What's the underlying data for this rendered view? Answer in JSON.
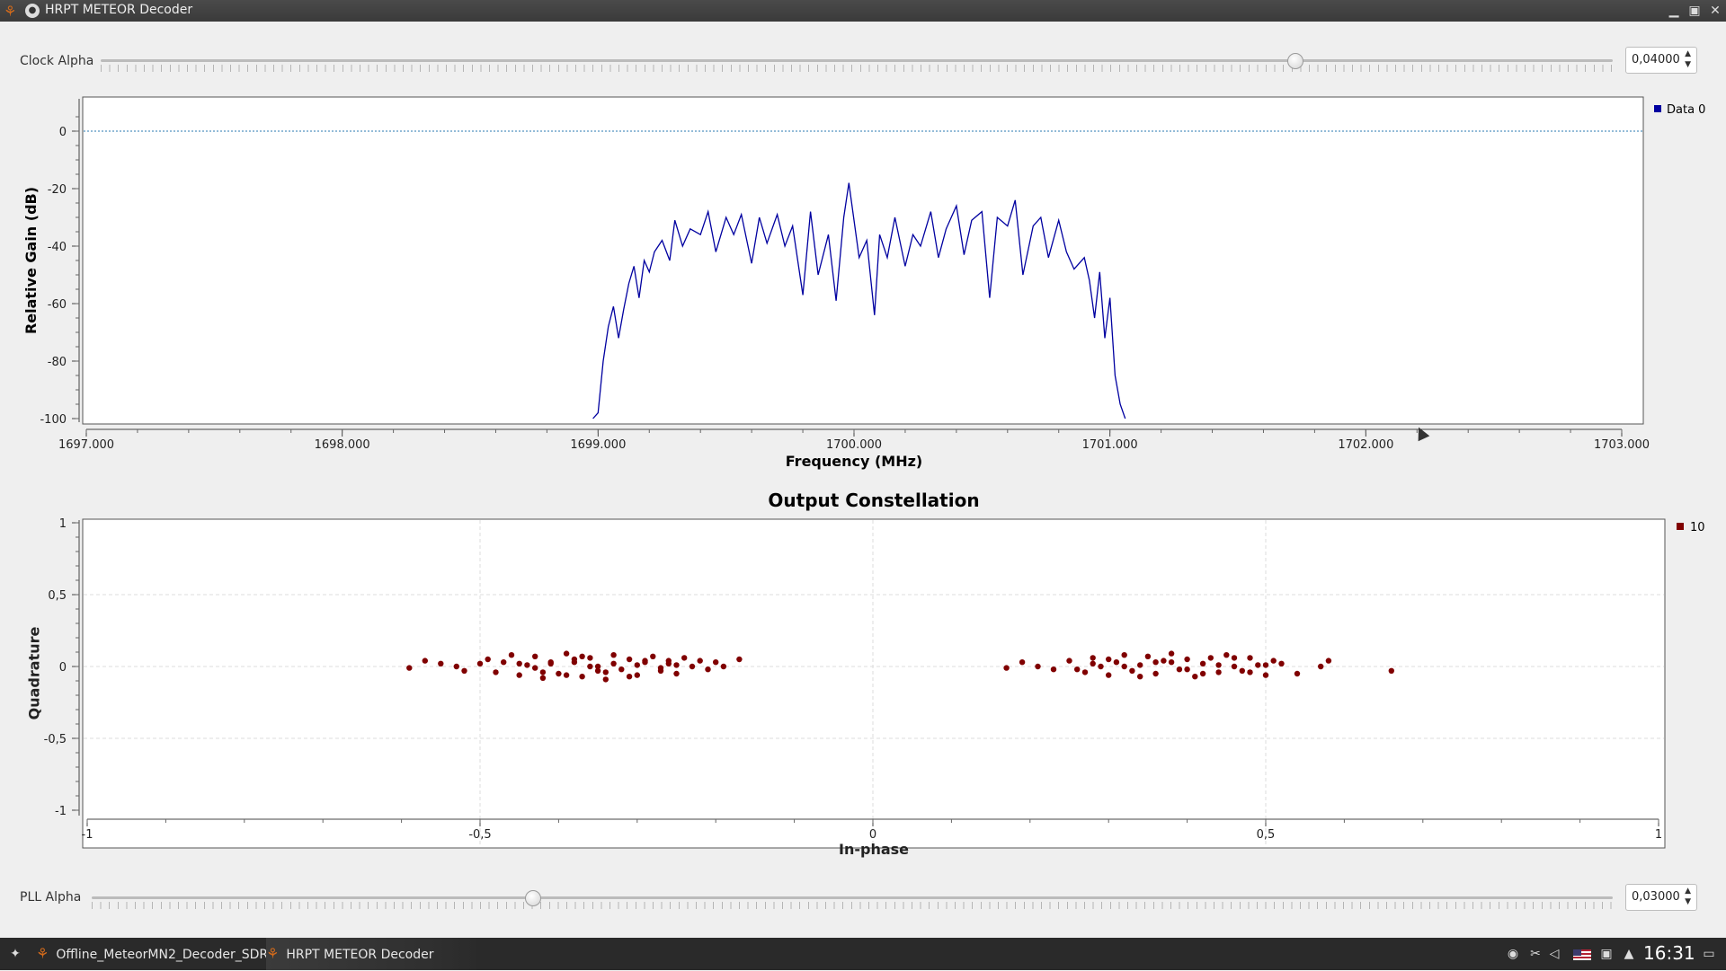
{
  "window": {
    "title": "HRPT METEOR Decoder"
  },
  "clock_alpha": {
    "label": "Clock Alpha",
    "value": "0,04000",
    "position_fraction": 0.79
  },
  "pll_alpha": {
    "label": "PLL Alpha",
    "value": "0,03000",
    "position_fraction": 0.29
  },
  "colors": {
    "spectrum_line": "#0000a0",
    "constellation_points": "#800000"
  },
  "taskbar": {
    "tasks": [
      {
        "label": "Offline_MeteorMN2_Decoder_SDR..."
      },
      {
        "label": "HRPT METEOR Decoder"
      }
    ],
    "clock": "16:31"
  },
  "chart_data": [
    {
      "type": "line",
      "title": "",
      "xlabel": "Frequency (MHz)",
      "ylabel": "Relative Gain (dB)",
      "xlim": [
        1697.0,
        1703.0
      ],
      "ylim": [
        -100,
        10
      ],
      "xticks": [
        "1697.000",
        "1698.000",
        "1699.000",
        "1700.000",
        "1701.000",
        "1702.000",
        "1703.000"
      ],
      "yticks": [
        "0",
        "-20",
        "-40",
        "-60",
        "-80",
        "-100"
      ],
      "reference_line_y": 0,
      "legend": {
        "placement": "top-right",
        "entries": [
          "Data 0"
        ]
      },
      "series": [
        {
          "name": "Data 0",
          "x": [
            1698.98,
            1699.0,
            1699.02,
            1699.04,
            1699.06,
            1699.08,
            1699.1,
            1699.12,
            1699.14,
            1699.16,
            1699.18,
            1699.2,
            1699.22,
            1699.25,
            1699.28,
            1699.3,
            1699.33,
            1699.36,
            1699.4,
            1699.43,
            1699.46,
            1699.5,
            1699.53,
            1699.56,
            1699.6,
            1699.63,
            1699.66,
            1699.7,
            1699.73,
            1699.76,
            1699.8,
            1699.83,
            1699.86,
            1699.9,
            1699.93,
            1699.96,
            1699.98,
            1700.02,
            1700.05,
            1700.08,
            1700.1,
            1700.13,
            1700.16,
            1700.2,
            1700.23,
            1700.26,
            1700.3,
            1700.33,
            1700.36,
            1700.4,
            1700.43,
            1700.46,
            1700.5,
            1700.53,
            1700.56,
            1700.6,
            1700.63,
            1700.66,
            1700.7,
            1700.73,
            1700.76,
            1700.8,
            1700.83,
            1700.86,
            1700.9,
            1700.92,
            1700.94,
            1700.96,
            1700.98,
            1701.0,
            1701.02,
            1701.04,
            1701.06
          ],
          "values": [
            -100,
            -98,
            -80,
            -68,
            -61,
            -72,
            -62,
            -53,
            -47,
            -58,
            -45,
            -49,
            -42,
            -38,
            -45,
            -31,
            -40,
            -34,
            -36,
            -28,
            -42,
            -30,
            -36,
            -29,
            -46,
            -30,
            -39,
            -29,
            -40,
            -33,
            -57,
            -28,
            -50,
            -36,
            -59,
            -30,
            -18,
            -44,
            -38,
            -64,
            -36,
            -44,
            -30,
            -47,
            -36,
            -40,
            -28,
            -44,
            -34,
            -26,
            -43,
            -31,
            -28,
            -58,
            -30,
            -33,
            -24,
            -50,
            -33,
            -30,
            -44,
            -31,
            -42,
            -48,
            -44,
            -52,
            -65,
            -49,
            -72,
            -58,
            -85,
            -95,
            -100
          ]
        }
      ]
    },
    {
      "type": "scatter",
      "title": "Output Constellation",
      "xlabel": "In-phase",
      "ylabel": "Quadrature",
      "xlim": [
        -1,
        1
      ],
      "ylim": [
        -1,
        1
      ],
      "xticks": [
        "-1",
        "-0,5",
        "0",
        "0,5",
        "1"
      ],
      "yticks": [
        "1",
        "0,5",
        "0",
        "-0,5",
        "-1"
      ],
      "grid": true,
      "legend": {
        "placement": "top-right",
        "entries": [
          "10"
        ]
      },
      "series": [
        {
          "name": "10",
          "x": [
            -0.59,
            -0.57,
            -0.55,
            -0.53,
            -0.52,
            -0.5,
            -0.49,
            -0.48,
            -0.47,
            -0.46,
            -0.45,
            -0.44,
            -0.43,
            -0.42,
            -0.41,
            -0.4,
            -0.39,
            -0.38,
            -0.37,
            -0.36,
            -0.35,
            -0.34,
            -0.33,
            -0.32,
            -0.31,
            -0.3,
            -0.29,
            -0.28,
            -0.27,
            -0.26,
            -0.25,
            -0.24,
            -0.23,
            -0.22,
            -0.21,
            -0.2,
            -0.19,
            -0.17,
            -0.43,
            -0.41,
            -0.39,
            -0.37,
            -0.35,
            -0.33,
            -0.31,
            -0.29,
            -0.27,
            -0.25,
            -0.45,
            -0.38,
            -0.34,
            -0.3,
            -0.26,
            -0.42,
            -0.36,
            0.17,
            0.19,
            0.21,
            0.23,
            0.25,
            0.27,
            0.28,
            0.29,
            0.3,
            0.31,
            0.32,
            0.33,
            0.34,
            0.35,
            0.36,
            0.37,
            0.38,
            0.39,
            0.4,
            0.41,
            0.42,
            0.43,
            0.44,
            0.45,
            0.46,
            0.47,
            0.48,
            0.49,
            0.5,
            0.51,
            0.52,
            0.54,
            0.57,
            0.58,
            0.66,
            0.26,
            0.3,
            0.34,
            0.38,
            0.42,
            0.46,
            0.5,
            0.32,
            0.36,
            0.4,
            0.44,
            0.28,
            0.48
          ],
          "y": [
            -0.01,
            0.04,
            0.02,
            0.0,
            -0.03,
            0.02,
            0.05,
            -0.04,
            0.03,
            0.08,
            -0.06,
            0.01,
            0.07,
            -0.08,
            0.02,
            -0.05,
            0.09,
            0.03,
            -0.07,
            0.06,
            0.0,
            -0.04,
            0.08,
            -0.02,
            0.05,
            -0.06,
            0.03,
            0.07,
            -0.03,
            0.02,
            -0.05,
            0.06,
            0.0,
            0.04,
            -0.02,
            0.03,
            0.0,
            0.05,
            -0.01,
            0.03,
            -0.06,
            0.07,
            -0.03,
            0.02,
            -0.07,
            0.04,
            -0.01,
            0.01,
            0.02,
            0.05,
            -0.09,
            0.01,
            0.04,
            -0.04,
            0.0,
            -0.01,
            0.03,
            0.0,
            -0.02,
            0.04,
            -0.04,
            0.06,
            0.0,
            -0.06,
            0.03,
            0.08,
            -0.03,
            0.01,
            0.07,
            -0.05,
            0.04,
            0.09,
            -0.02,
            0.05,
            -0.07,
            0.02,
            0.06,
            -0.04,
            0.08,
            0.0,
            -0.03,
            0.06,
            0.01,
            -0.06,
            0.04,
            0.02,
            -0.05,
            0.0,
            0.04,
            -0.03,
            -0.02,
            0.05,
            -0.07,
            0.03,
            -0.05,
            0.06,
            0.01,
            0.0,
            0.03,
            -0.02,
            0.01,
            0.02,
            -0.04
          ]
        }
      ]
    }
  ]
}
